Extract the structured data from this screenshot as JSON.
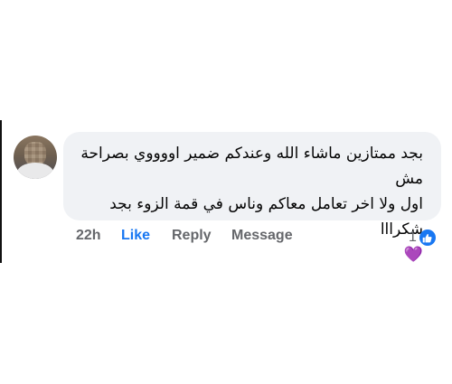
{
  "comment": {
    "avatar_icon": "user-avatar",
    "line1": "بجد ممتازين ماشاء الله وعندكم ضمير اووووي بصراحة مش",
    "line2": "اول ولا اخر تعامل معاكم وناس في قمة الزوء بجد شكرااا",
    "emoji": "💜",
    "emoji_icon": "purple-heart-icon",
    "bubble_color": "#f0f2f5"
  },
  "actions": {
    "time": "22h",
    "like_label": "Like",
    "reply_label": "Reply",
    "message_label": "Message",
    "like_color": "#1877f2"
  },
  "reactions": {
    "count": "1",
    "icon": "thumbs-up-icon",
    "icon_color": "#1877f2"
  }
}
